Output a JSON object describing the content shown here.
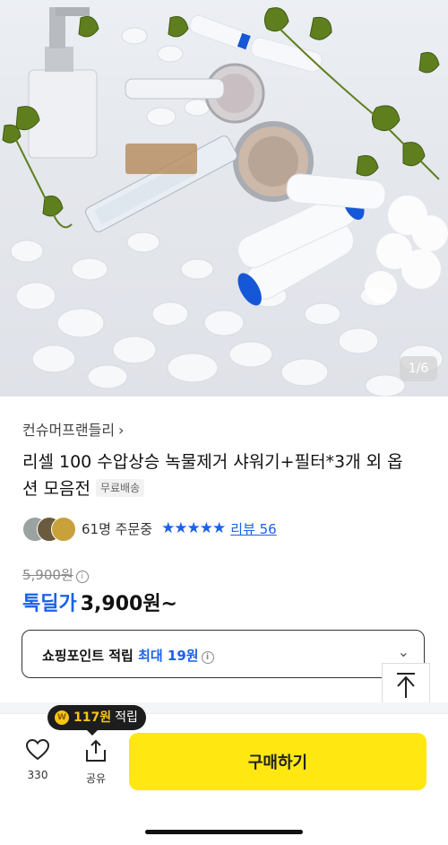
{
  "gallery": {
    "pager": "1/6"
  },
  "product": {
    "seller": "컨슈머프랜들리",
    "title": "리셀 100 수압상승 녹물제거 샤워기+필터*3개 외 옵션 모음전",
    "shipping_badge": "무료배송",
    "order_count": "61명 주문중",
    "stars": "★★★★★",
    "review_link": "리뷰 56",
    "original_price": "5,900원",
    "deal_label": "톡딜가",
    "deal_price": "3,900원~"
  },
  "points": {
    "label": "쇼핑포인트 적립",
    "max_label": "최대 19원"
  },
  "tooltip": {
    "coin": "W",
    "amount": "117원",
    "suffix": "적립"
  },
  "bottom": {
    "like_count": "330",
    "share_label": "공유",
    "buy_label": "구매하기"
  },
  "colors": {
    "accent_blue": "#1a62e8",
    "buy_yellow": "#ffe812"
  }
}
